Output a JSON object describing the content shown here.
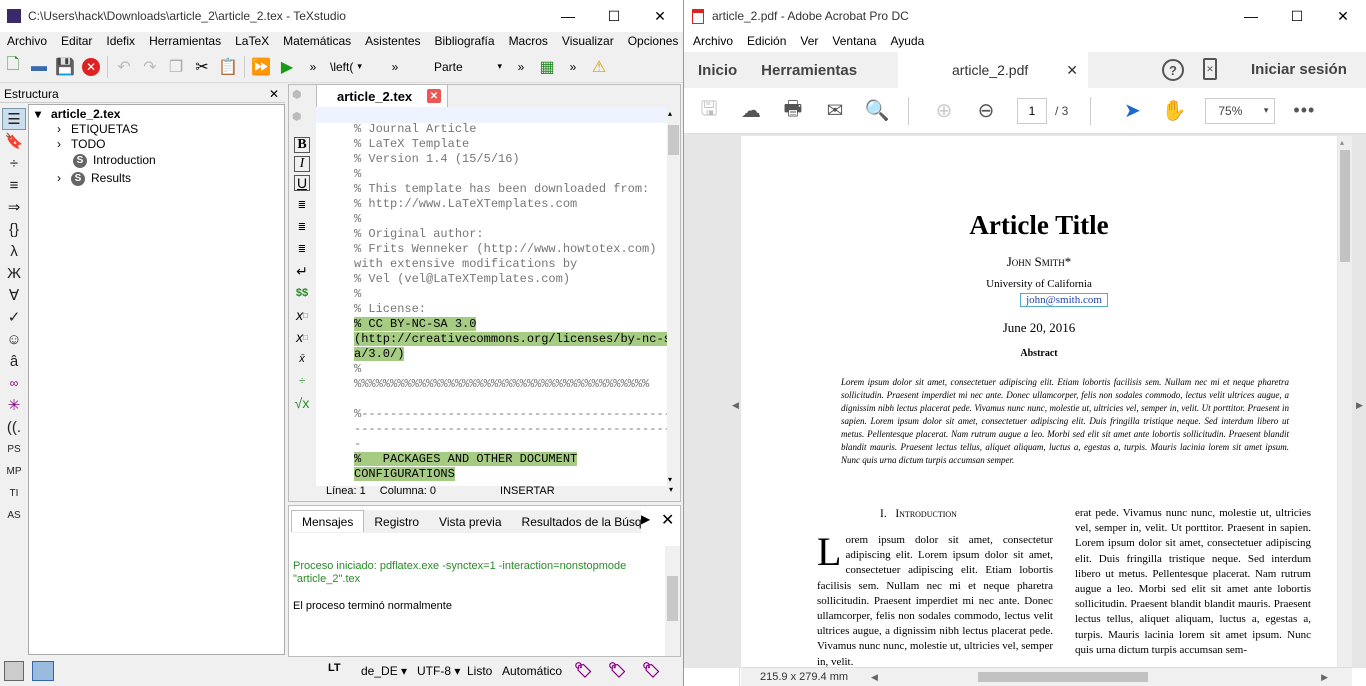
{
  "texstudio": {
    "title": "C:\\Users\\hack\\Downloads\\article_2\\article_2.tex - TeXstudio",
    "menu": [
      "Archivo",
      "Editar",
      "Idefix",
      "Herramientas",
      "LaTeX",
      "Matemáticas",
      "Asistentes",
      "Bibliografía",
      "Macros",
      "Visualizar",
      "Opciones"
    ],
    "toolbar": {
      "left_dropdown": "\\left(",
      "part_dropdown": "Parte"
    },
    "structure": {
      "header": "Estructura",
      "root": "article_2.tex",
      "items": [
        "ETIQUETAS",
        "TODO",
        "Introduction",
        "Results"
      ]
    },
    "tab": "article_2.tex",
    "editor_lines": [
      {
        "t": "%%%%%%%%%%%%%%%%%%%%%%%%%%%%%%%%%%%%%%%%%",
        "h": false
      },
      {
        "t": "% Journal Article",
        "h": false
      },
      {
        "t": "% LaTeX Template",
        "h": false
      },
      {
        "t": "% Version 1.4 (15/5/16)",
        "h": false
      },
      {
        "t": "%",
        "h": false
      },
      {
        "t": "% This template has been downloaded from:",
        "h": false
      },
      {
        "t": "% http://www.LaTeXTemplates.com",
        "h": false
      },
      {
        "t": "%",
        "h": false
      },
      {
        "t": "% Original author:",
        "h": false
      },
      {
        "t": "% Frits Wenneker (http://www.howtotex.com)",
        "h": false
      },
      {
        "t": "with extensive modifications by",
        "h": false
      },
      {
        "t": "% Vel (vel@LaTeXTemplates.com)",
        "h": false
      },
      {
        "t": "%",
        "h": false
      },
      {
        "t": "% License:",
        "h": false
      },
      {
        "t": "% CC BY-NC-SA 3.0",
        "h": true
      },
      {
        "t": "(http://creativecommons.org/licenses/by-nc-s",
        "h": true
      },
      {
        "t": "a/3.0/)",
        "h": true
      },
      {
        "t": "%",
        "h": false
      },
      {
        "t": "%%%%%%%%%%%%%%%%%%%%%%%%%%%%%%%%%%%%%%%%%",
        "h": false
      },
      {
        "t": "",
        "h": false
      },
      {
        "t": "%----------------------------------------------",
        "h": false
      },
      {
        "t": "----------------------------------------------",
        "h": false
      },
      {
        "t": "-",
        "h": false
      },
      {
        "t": "%   PACKAGES AND OTHER DOCUMENT",
        "h": true
      },
      {
        "t": "CONFIGURATIONS",
        "h": true
      }
    ],
    "editor_status": {
      "line": "Línea: 1",
      "col": "Columna: 0",
      "mode": "INSERTAR"
    },
    "msg_tabs": [
      "Mensajes",
      "Registro",
      "Vista previa",
      "Resultados de la Búsqueda"
    ],
    "messages": [
      "Proceso iniciado: pdflatex.exe -synctex=1 -interaction=nonstopmode \"article_2\".tex",
      "El proceso terminó normalmente"
    ],
    "status": {
      "lang": "de_DE",
      "enc": "UTF-8",
      "ready": "Listo",
      "auto": "Automático"
    }
  },
  "acrobat": {
    "title": "article_2.pdf - Adobe Acrobat Pro DC",
    "menu": [
      "Archivo",
      "Edición",
      "Ver",
      "Ventana",
      "Ayuda"
    ],
    "tabs": {
      "home": "Inicio",
      "tools": "Herramientas",
      "doc": "article_2.pdf",
      "signin": "Iniciar sesión"
    },
    "page": {
      "current": "1",
      "total": "/ 3",
      "zoom": "75%"
    },
    "doc": {
      "title": "Article Title",
      "author": "John Smith*",
      "affil": "University of California",
      "email": "john@smith.com",
      "date": "June 20, 2016",
      "abstract_h": "Abstract",
      "abstract": "Lorem ipsum dolor sit amet, consectetuer adipiscing elit. Etiam lobortis facilisis sem. Nullam nec mi et neque pharetra sollicitudin. Praesent imperdiet mi nec ante. Donec ullamcorper, felis non sodales commodo, lectus velit ultrices augue, a dignissim nibh lectus placerat pede. Vivamus nunc nunc, molestie ut, ultricies vel, semper in, velit. Ut porttitor. Praesent in sapien. Lorem ipsum dolor sit amet, consectetuer adipiscing elit. Duis fringilla tristique neque. Sed interdum libero ut metus. Pellentesque placerat. Nam rutrum augue a leo. Morbi sed elit sit amet ante lobortis sollicitudin. Praesent blandit blandit mauris. Praesent lectus tellus, aliquet aliquam, luctus a, egestas a, turpis. Mauris lacinia lorem sit amet ipsum. Nunc quis urna dictum turpis accumsan semper.",
      "section": "I.   Introduction",
      "col1": "orem ipsum dolor sit amet, consectetur adipiscing elit. Lorem ipsum dolor sit amet, consectetuer adipiscing elit. Etiam lobortis facilisis sem. Nullam nec mi et neque pharetra sollicitudin. Praesent imperdiet mi nec ante. Donec ullamcorper, felis non sodales commodo, lectus velit ultrices augue, a dignissim nibh lectus placerat pede. Vivamus nunc nunc, molestie ut, ultricies vel, semper in, velit.",
      "col2": "erat pede. Vivamus nunc nunc, molestie ut, ultricies vel, semper in, velit. Ut porttitor. Praesent in sapien. Lorem ipsum dolor sit amet, consectetuer adipiscing elit. Duis fringilla tristique neque. Sed interdum libero ut metus. Pellentesque placerat. Nam rutrum augue a leo. Morbi sed elit sit amet ante lobortis sollicitudin. Praesent blandit blandit mauris. Praesent lectus tellus, aliquet aliquam, luctus a, egestas a, turpis. Mauris lacinia lorem sit amet ipsum. Nunc quis urna dictum turpis accumsan sem-"
    },
    "pagesize": "215.9 x 279.4 mm"
  }
}
